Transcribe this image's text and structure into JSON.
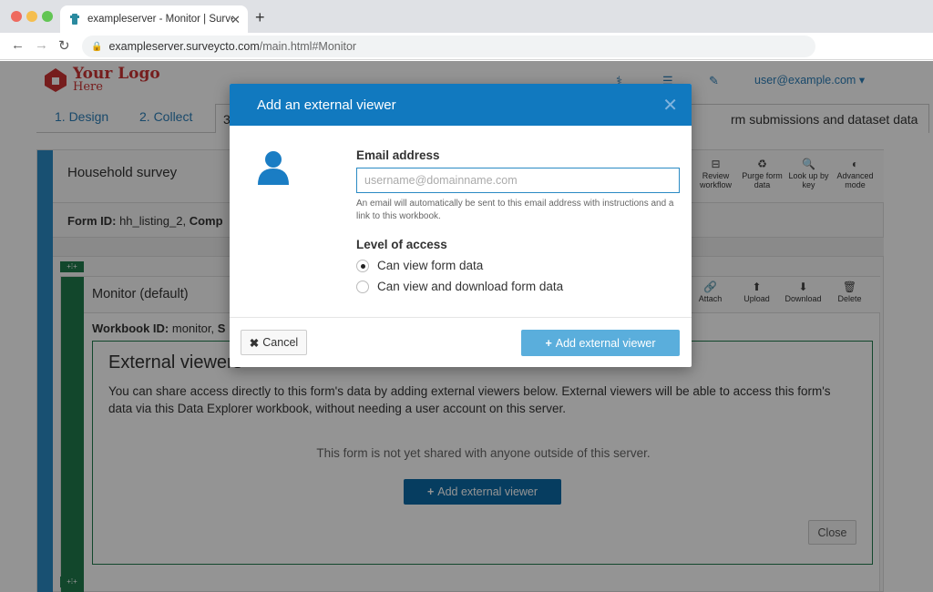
{
  "browser": {
    "tab_title": "exampleserver - Monitor | Survey",
    "tab_close": "✕",
    "new_tab": "+",
    "url_host": "exampleserver.surveycto.com",
    "url_path": "/main.html#Monitor"
  },
  "header": {
    "logo_line1": "Your Logo",
    "logo_line2": "Here",
    "user": "user@example.com ▾"
  },
  "nav": {
    "tabs": [
      "1. Design",
      "2. Collect"
    ],
    "active_tab_fragment": "3",
    "active_tab_label": "rm submissions and dataset data"
  },
  "form": {
    "title": "Household survey",
    "id_label": "Form ID:",
    "id_value": "hh_listing_2,",
    "id_cut": "Comp",
    "tools": [
      {
        "icon": "⊟",
        "label": "Review workflow"
      },
      {
        "icon": "♻",
        "label": "Purge form data"
      },
      {
        "icon": "🔍",
        "label": "Look up by key"
      },
      {
        "icon": "◐",
        "label": "Advanced mode"
      }
    ]
  },
  "workbook": {
    "title": "Monitor (default)",
    "id_label": "Workbook ID:",
    "id_value": "monitor,",
    "id_cut": "S",
    "tools": [
      {
        "icon": "🔗",
        "label": "Attach"
      },
      {
        "icon": "⬆",
        "label": "Upload"
      },
      {
        "icon": "⬇",
        "label": "Download"
      },
      {
        "icon": "🗑",
        "label": "Delete"
      }
    ]
  },
  "external_viewers": {
    "title": "External viewers",
    "description": "You can share access directly to this form's data by adding external viewers below. External viewers will be able to access this form's data via this Data Explorer workbook, without needing a user account on this server.",
    "empty_text": "This form is not yet shared with anyone outside of this server.",
    "add_button": "Add external viewer",
    "close_button": "Close"
  },
  "modal": {
    "title": "Add an external viewer",
    "close": "✕",
    "email_label": "Email address",
    "email_placeholder": "username@domainname.com",
    "email_value": "",
    "email_help": "An email will automatically be sent to this email address with instructions and a link to this workbook.",
    "access_label": "Level of access",
    "access_options": [
      {
        "label": "Can view form data",
        "selected": true
      },
      {
        "label": "Can view and download form data",
        "selected": false
      }
    ],
    "cancel_button": "Cancel",
    "add_button": "Add external viewer"
  },
  "colors": {
    "modal_header": "#1179bf",
    "primary_button": "#0c6aa6",
    "add_button_disabled": "#5aaedc",
    "form_sidebar": "#2a8ac4",
    "workbook_sidebar": "#1f7a4d"
  }
}
